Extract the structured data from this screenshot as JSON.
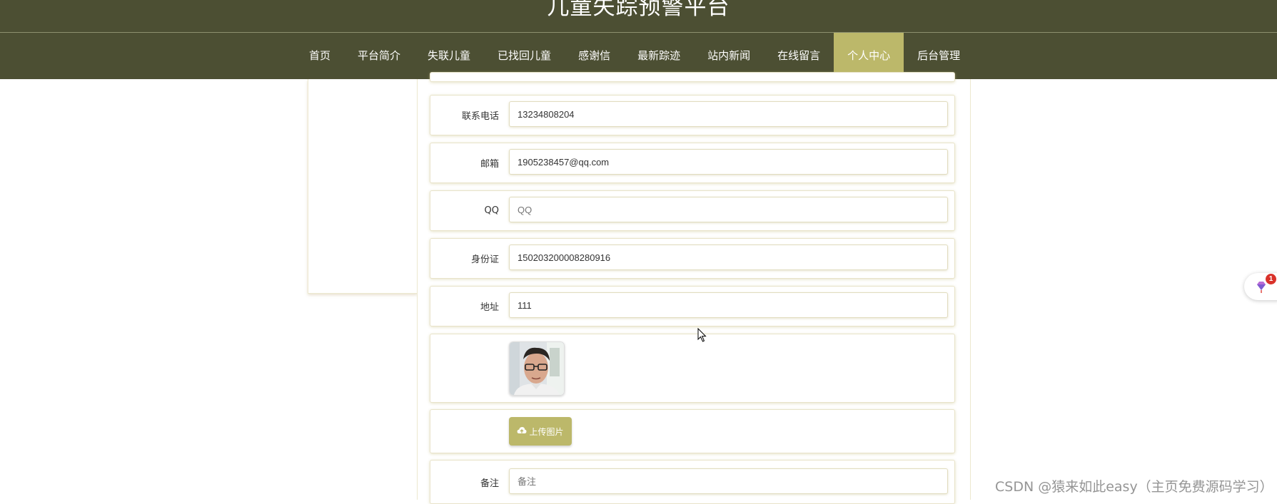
{
  "header": {
    "site_title": "儿童失踪预警平台"
  },
  "nav": {
    "items": [
      {
        "label": "首页"
      },
      {
        "label": "平台简介"
      },
      {
        "label": "失联儿童"
      },
      {
        "label": "已找回儿童"
      },
      {
        "label": "感谢信"
      },
      {
        "label": "最新踪迹"
      },
      {
        "label": "站内新闻"
      },
      {
        "label": "在线留言"
      },
      {
        "label": "个人中心"
      },
      {
        "label": "后台管理"
      }
    ],
    "active": "个人中心"
  },
  "form": {
    "phone": {
      "label": "联系电话",
      "value": "13234808204"
    },
    "email": {
      "label": "邮箱",
      "value": "1905238457@qq.com"
    },
    "qq": {
      "label": "QQ",
      "value": "",
      "placeholder": "QQ"
    },
    "id_card": {
      "label": "身份证",
      "value": "150203200008280916"
    },
    "address": {
      "label": "地址",
      "value": "111"
    },
    "upload_label": "上传图片",
    "remark": {
      "label": "备注",
      "value": "",
      "placeholder": "备注"
    }
  },
  "widget": {
    "badge_count": "1"
  },
  "watermark": "CSDN @猿来如此easy（主页免费源码学习）",
  "colors": {
    "nav_bg": "#4c4f33",
    "accent": "#bcb86a",
    "badge": "#d9322a"
  }
}
